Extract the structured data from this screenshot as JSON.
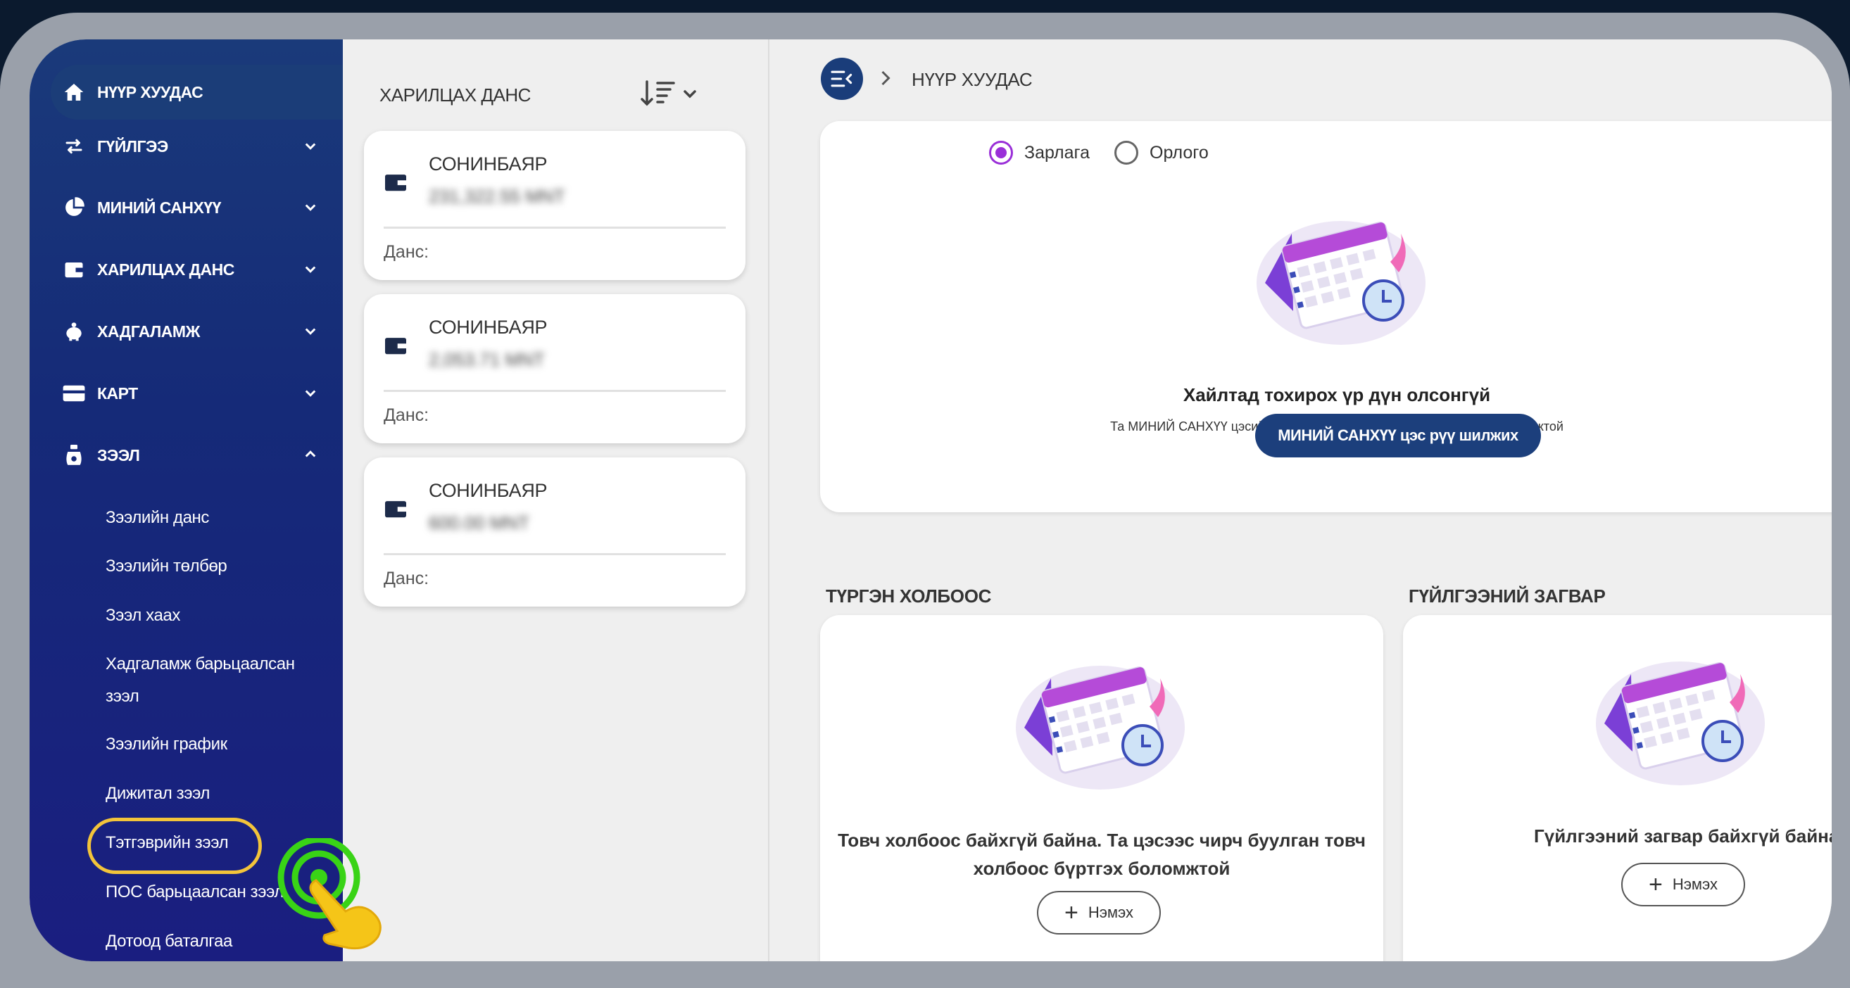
{
  "sidebar": {
    "items": [
      {
        "label": "НҮҮР ХУУДАС",
        "icon": "home-icon"
      },
      {
        "label": "ГҮЙЛГЭЭ",
        "icon": "transfer-icon"
      },
      {
        "label": "МИНИЙ САНХҮҮ",
        "icon": "pie-chart-icon"
      },
      {
        "label": "ХАРИЛЦАХ ДАНС",
        "icon": "wallet-icon"
      },
      {
        "label": "ХАДГАЛАМЖ",
        "icon": "piggy-bank-icon"
      },
      {
        "label": "КАРТ",
        "icon": "card-icon"
      },
      {
        "label": "ЗЭЭЛ",
        "icon": "money-bag-icon"
      }
    ],
    "loan_subitems": [
      "Зээлийн данс",
      "Зээлийн төлбөр",
      "Зээл хаах",
      "Хадгаламж барьцаалсан",
      "зээл",
      "Зээлийн график",
      "Дижитал зээл",
      "Тэтгэврийн зээл",
      "ПОС барьцаалсан зээл",
      "Дотоод баталгаа"
    ]
  },
  "accounts": {
    "title": "ХАРИЛЦАХ ДАНС",
    "items": [
      {
        "name": "СОНИНБАЯР",
        "balance": "231,322.55 MNT",
        "account_label": "Данс:"
      },
      {
        "name": "СОНИНБАЯР",
        "balance": "2,053.71 MNT",
        "account_label": "Данс:"
      },
      {
        "name": "СОНИНБАЯР",
        "balance": "600.00 MNT",
        "account_label": "Данс:"
      }
    ]
  },
  "header": {
    "breadcrumb": "НҮҮР ХУУДАС"
  },
  "finance_panel": {
    "radio_expense": "Зарлага",
    "radio_income": "Орлого",
    "empty_title": "Хайлтад тохирох үр дүн олсонгүй",
    "empty_subtitle": "Та МИНИЙ САНХҮҮ цэсийг ашигласнаар өөрийн санхүүгээ хянах боломжтой",
    "goto_button": "МИНИЙ САНХҮҮ цэс рүү шилжих"
  },
  "quick_links": {
    "title": "ТҮРГЭН ХОЛБООС",
    "empty_line1": "Товч холбоос байхгүй байна. Та цэсээс чирч буулган товч",
    "empty_line2": "холбоос бүртгэх боломжтой",
    "add_label": "Нэмэх"
  },
  "templates": {
    "title": "ГҮЙЛГЭЭНИЙ ЗАГВАР",
    "empty_text": "Гүйлгээний загвар байхгүй байна",
    "add_label": "Нэмэх"
  },
  "colors": {
    "sidebar_top": "#1a3a7a",
    "sidebar_bottom": "#1a1e80",
    "primary_button": "#1c3f7c",
    "radio_accent": "#9a2fd8",
    "highlight": "#f3c43a",
    "click_indicator": "#39d316"
  }
}
